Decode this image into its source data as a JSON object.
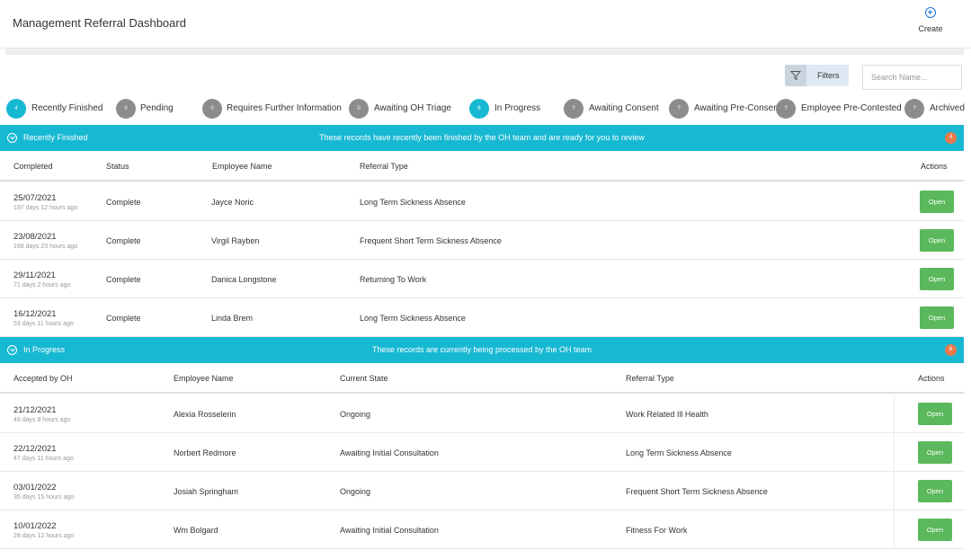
{
  "header": {
    "title": "Management Referral Dashboard",
    "create_label": "Create"
  },
  "toolbar": {
    "filters_label": "Filters",
    "search_placeholder": "Search Name..."
  },
  "tabs": [
    {
      "badge": "4",
      "label": "Recently Finished",
      "color": "#17b8d2"
    },
    {
      "badge": "0",
      "label": "Pending",
      "color": "#8c8c8c"
    },
    {
      "badge": "0",
      "label": "Requires Further Information",
      "color": "#8c8c8c"
    },
    {
      "badge": "0",
      "label": "Awaiting OH Triage",
      "color": "#8c8c8c"
    },
    {
      "badge": "6",
      "label": "In Progress",
      "color": "#17b8d2"
    },
    {
      "badge": "?",
      "label": "Awaiting Consent",
      "color": "#8c8c8c"
    },
    {
      "badge": "?",
      "label": "Awaiting Pre-Consen",
      "color": "#8c8c8c"
    },
    {
      "badge": "?",
      "label": "Employee Pre-Contested",
      "color": "#8c8c8c"
    },
    {
      "badge": "?",
      "label": "Archived",
      "color": "#8c8c8c"
    }
  ],
  "recently_finished": {
    "title": "Recently Finished",
    "message": "These records have recently been finished by the OH team and are ready for you to review",
    "count": "4",
    "columns": [
      "Completed",
      "Status",
      "Employee Name",
      "Referral Type",
      "Actions"
    ],
    "rows": [
      {
        "date": "25/07/2021",
        "ago": "197 days 12 hours ago",
        "status": "Complete",
        "employee": "Jayce Noric",
        "referral_type": "Long Term Sickness Absence",
        "action": "Open"
      },
      {
        "date": "23/08/2021",
        "ago": "168 days 23 hours ago",
        "status": "Complete",
        "employee": "Virgil Rayben",
        "referral_type": "Frequent Short Term Sickness Absence",
        "action": "Open"
      },
      {
        "date": "29/11/2021",
        "ago": "71 days 2 hours ago",
        "status": "Complete",
        "employee": "Danica Longstone",
        "referral_type": "Returning To Work",
        "action": "Open"
      },
      {
        "date": "16/12/2021",
        "ago": "53 days 11 hours ago",
        "status": "Complete",
        "employee": "Linda Brem",
        "referral_type": "Long Term Sickness Absence",
        "action": "Open"
      }
    ]
  },
  "in_progress": {
    "title": "In Progress",
    "message": "These records are currently being processed by the OH team",
    "count": "6",
    "columns": [
      "Accepted by OH",
      "Employee Name",
      "Current State",
      "Referral Type",
      "Actions"
    ],
    "rows": [
      {
        "date": "21/12/2021",
        "ago": "49 days 8 hours ago",
        "employee": "Alexia Rosselerin",
        "state": "Ongoing",
        "referral_type": "Work Related Ill Health",
        "action": "Open"
      },
      {
        "date": "22/12/2021",
        "ago": "47 days 11 hours ago",
        "employee": "Norbert Redmore",
        "state": "Awaiting Initial Consultation",
        "referral_type": "Long Term Sickness Absence",
        "action": "Open"
      },
      {
        "date": "03/01/2022",
        "ago": "35 days 15 hours ago",
        "employee": "Josiah Springham",
        "state": "Ongoing",
        "referral_type": "Frequent Short Term Sickness Absence",
        "action": "Open"
      },
      {
        "date": "10/01/2022",
        "ago": "28 days 12 hours ago",
        "employee": "Wm Bolgard",
        "state": "Awaiting Initial Consultation",
        "referral_type": "Fitness For Work",
        "action": "Open"
      }
    ]
  }
}
